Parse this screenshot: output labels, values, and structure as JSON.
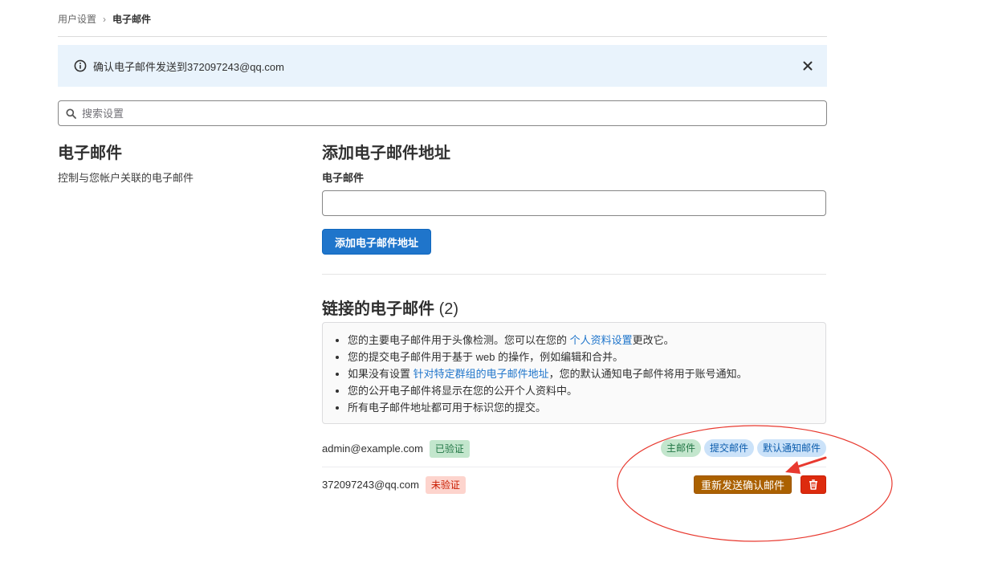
{
  "breadcrumb": {
    "parent": "用户设置",
    "separator": "›",
    "current": "电子邮件"
  },
  "alert": {
    "text": "确认电子邮件发送到372097243@qq.com",
    "icon": "info-icon",
    "close_icon": "close-icon"
  },
  "search": {
    "placeholder": "搜索设置",
    "value": ""
  },
  "section": {
    "title": "电子邮件",
    "description": "控制与您帐户关联的电子邮件"
  },
  "add_email": {
    "title": "添加电子邮件地址",
    "field_label": "电子邮件",
    "input_value": "",
    "button_label": "添加电子邮件地址"
  },
  "linked": {
    "title": "链接的电子邮件",
    "count": "(2)",
    "info": {
      "item1_before": "您的主要电子邮件用于头像检测。您可以在您的",
      "item1_link": "个人资料设置",
      "item1_after": "更改它。",
      "item2": "您的提交电子邮件用于基于 web 的操作，例如编辑和合并。",
      "item3_before": "如果没有设置",
      "item3_link": "针对特定群组的电子邮件地址",
      "item3_after": "，您的默认通知电子邮件将用于账号通知。",
      "item4": "您的公开电子邮件将显示在您的公开个人资料中。",
      "item5": "所有电子邮件地址都可用于标识您的提交。"
    },
    "emails": [
      {
        "address": "admin@example.com",
        "status": "已验证",
        "labels": [
          "主邮件",
          "提交邮件",
          "默认通知邮件"
        ]
      },
      {
        "address": "372097243@qq.com",
        "status": "未验证",
        "resend_label": "重新发送确认邮件",
        "delete_icon": "trash-icon"
      }
    ]
  },
  "colors": {
    "primary_button": "#1f75cb",
    "warning_button": "#ab6100",
    "danger_button": "#dd2b0e",
    "annotation": "#e8392f"
  }
}
